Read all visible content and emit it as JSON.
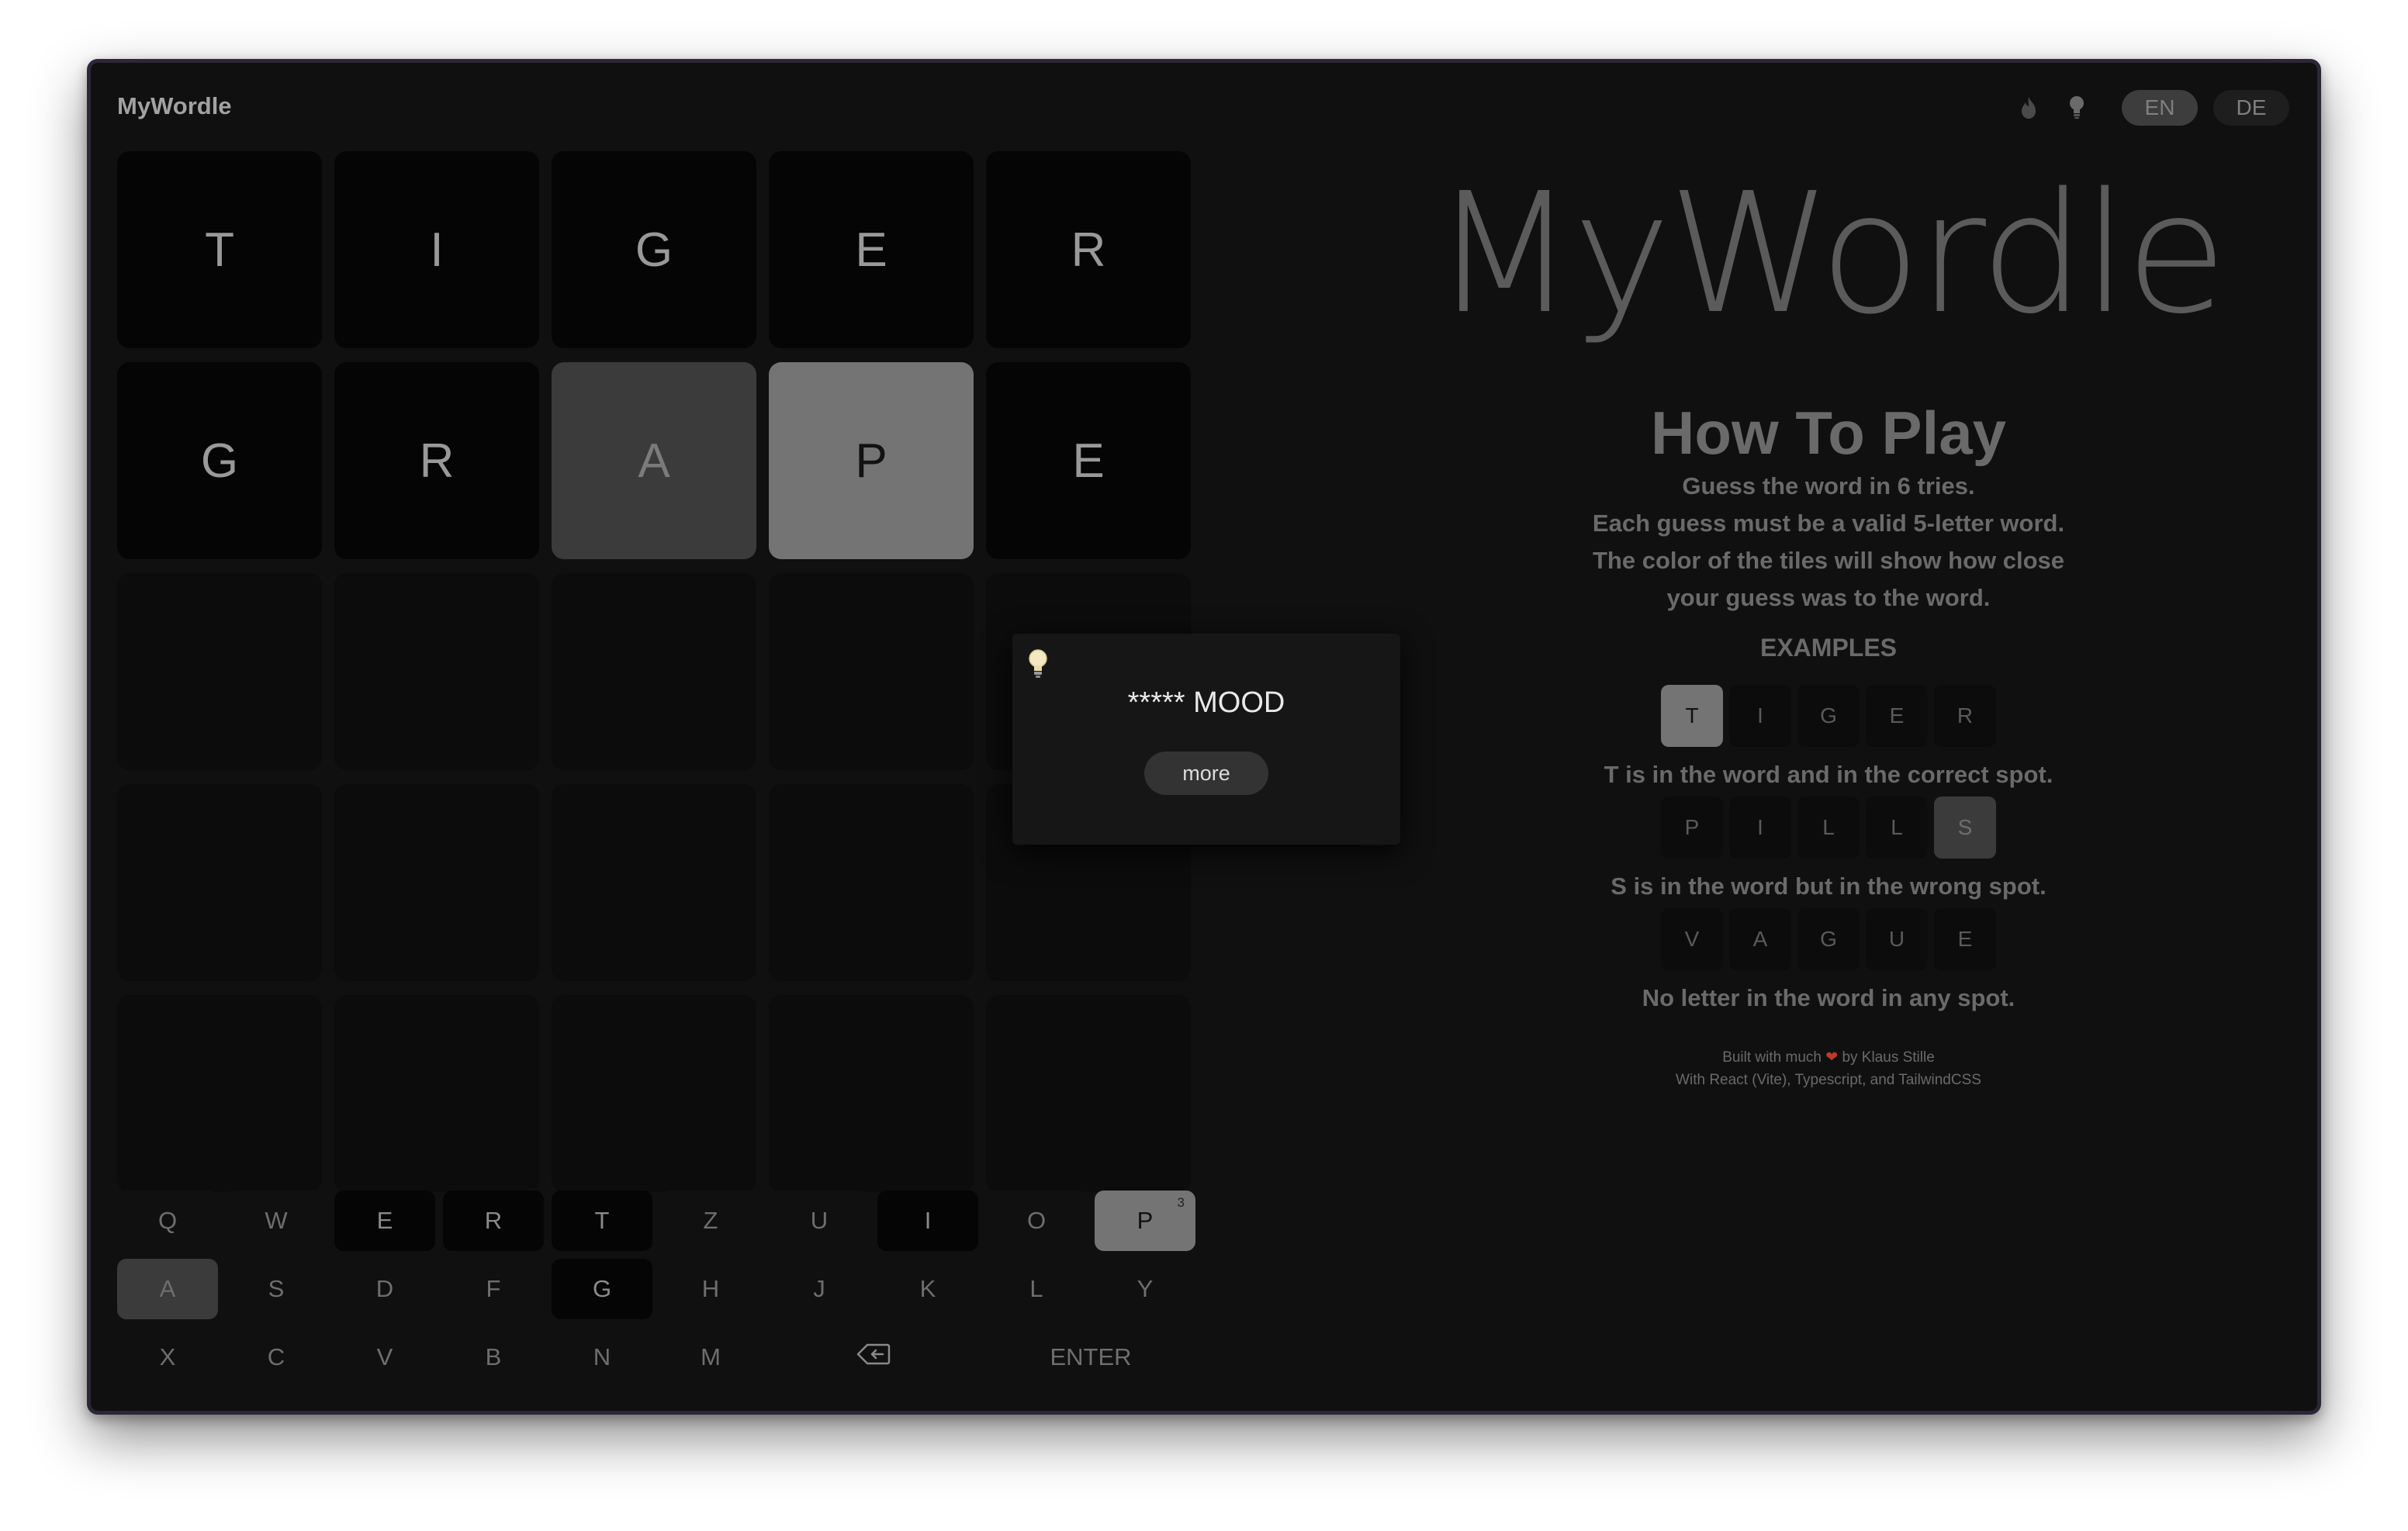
{
  "app": {
    "title": "MyWordle"
  },
  "header": {
    "languages": [
      "EN",
      "DE"
    ],
    "active_language": "EN",
    "icons": [
      "flame-icon",
      "lightbulb-icon"
    ]
  },
  "board": {
    "rows": [
      [
        {
          "letter": "T",
          "state": "absent"
        },
        {
          "letter": "I",
          "state": "absent"
        },
        {
          "letter": "G",
          "state": "absent"
        },
        {
          "letter": "E",
          "state": "absent"
        },
        {
          "letter": "R",
          "state": "absent"
        }
      ],
      [
        {
          "letter": "G",
          "state": "absent"
        },
        {
          "letter": "R",
          "state": "absent"
        },
        {
          "letter": "A",
          "state": "present"
        },
        {
          "letter": "P",
          "state": "correct"
        },
        {
          "letter": "E",
          "state": "absent"
        }
      ],
      [
        {
          "letter": "",
          "state": "empty"
        },
        {
          "letter": "",
          "state": "empty"
        },
        {
          "letter": "",
          "state": "empty"
        },
        {
          "letter": "",
          "state": "empty"
        },
        {
          "letter": "",
          "state": "empty"
        }
      ],
      [
        {
          "letter": "",
          "state": "empty"
        },
        {
          "letter": "",
          "state": "empty"
        },
        {
          "letter": "",
          "state": "empty"
        },
        {
          "letter": "",
          "state": "empty"
        },
        {
          "letter": "",
          "state": "empty"
        }
      ],
      [
        {
          "letter": "",
          "state": "empty"
        },
        {
          "letter": "",
          "state": "empty"
        },
        {
          "letter": "",
          "state": "empty"
        },
        {
          "letter": "",
          "state": "empty"
        },
        {
          "letter": "",
          "state": "empty"
        }
      ]
    ]
  },
  "keyboard": {
    "rows": [
      [
        {
          "label": "Q",
          "state": "unused"
        },
        {
          "label": "W",
          "state": "unused"
        },
        {
          "label": "E",
          "state": "absent"
        },
        {
          "label": "R",
          "state": "absent"
        },
        {
          "label": "T",
          "state": "absent"
        },
        {
          "label": "Z",
          "state": "unused"
        },
        {
          "label": "U",
          "state": "unused"
        },
        {
          "label": "I",
          "state": "absent"
        },
        {
          "label": "O",
          "state": "unused"
        },
        {
          "label": "P",
          "state": "correct",
          "count": "3"
        }
      ],
      [
        {
          "label": "A",
          "state": "present"
        },
        {
          "label": "S",
          "state": "unused"
        },
        {
          "label": "D",
          "state": "unused"
        },
        {
          "label": "F",
          "state": "unused"
        },
        {
          "label": "G",
          "state": "absent"
        },
        {
          "label": "H",
          "state": "unused"
        },
        {
          "label": "J",
          "state": "unused"
        },
        {
          "label": "K",
          "state": "unused"
        },
        {
          "label": "L",
          "state": "unused"
        },
        {
          "label": "Y",
          "state": "unused"
        }
      ],
      [
        {
          "label": "X",
          "state": "unused"
        },
        {
          "label": "C",
          "state": "unused"
        },
        {
          "label": "V",
          "state": "unused"
        },
        {
          "label": "B",
          "state": "unused"
        },
        {
          "label": "N",
          "state": "unused"
        },
        {
          "label": "M",
          "state": "unused"
        },
        {
          "label": "",
          "state": "unused",
          "icon": "backspace-icon",
          "wide": true
        },
        {
          "label": "ENTER",
          "state": "unused",
          "wide": true
        }
      ]
    ]
  },
  "hint_popup": {
    "icon": "lightbulb-icon",
    "text": "***** MOOD",
    "more_label": "more"
  },
  "howto": {
    "logo": "MyWordle",
    "title": "How To Play",
    "description": [
      "Guess the word in 6 tries.",
      "Each guess must be a valid 5-letter word.",
      "The color of the tiles will show how close",
      "your guess was to the word."
    ],
    "examples_heading": "EXAMPLES",
    "examples": [
      {
        "tiles": [
          {
            "letter": "T",
            "state": "correct"
          },
          {
            "letter": "I",
            "state": "empty"
          },
          {
            "letter": "G",
            "state": "empty"
          },
          {
            "letter": "E",
            "state": "empty"
          },
          {
            "letter": "R",
            "state": "empty"
          }
        ],
        "caption": "T is in the word and in the correct spot."
      },
      {
        "tiles": [
          {
            "letter": "P",
            "state": "empty"
          },
          {
            "letter": "I",
            "state": "empty"
          },
          {
            "letter": "L",
            "state": "empty"
          },
          {
            "letter": "L",
            "state": "empty"
          },
          {
            "letter": "S",
            "state": "present"
          }
        ],
        "caption": "S is in the word but in the wrong spot."
      },
      {
        "tiles": [
          {
            "letter": "V",
            "state": "empty"
          },
          {
            "letter": "A",
            "state": "empty"
          },
          {
            "letter": "G",
            "state": "empty"
          },
          {
            "letter": "U",
            "state": "empty"
          },
          {
            "letter": "E",
            "state": "empty"
          }
        ],
        "caption": "No letter in the word in any spot."
      }
    ],
    "footer": {
      "line1_prefix": "Built with much",
      "line1_suffix": "by Klaus Stille",
      "line2": "With React (Vite), Typescript, and TailwindCSS"
    }
  },
  "colors": {
    "background": "#101010",
    "correct": "#747474",
    "present": "#3b3b3b",
    "absent": "#050505",
    "window_border": "#2d2639"
  }
}
